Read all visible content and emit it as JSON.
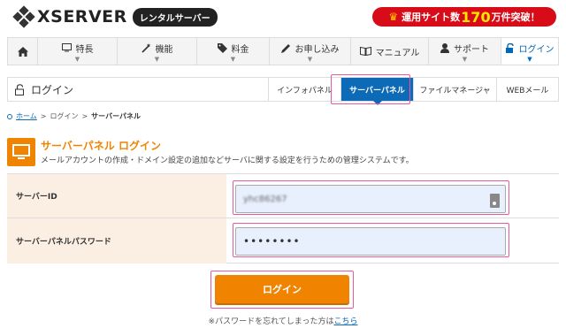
{
  "header": {
    "logo_text": "XSERVER",
    "logo_badge": "レンタルサーバー",
    "campaign_prefix": "運用サイト数",
    "campaign_number": "170",
    "campaign_suffix": "万件突破！"
  },
  "nav": {
    "items": [
      {
        "label": "",
        "icon": "home-icon"
      },
      {
        "label": "特長",
        "icon": "monitor-icon"
      },
      {
        "label": "機能",
        "icon": "magic-wand-icon"
      },
      {
        "label": "料金",
        "icon": "tag-icon"
      },
      {
        "label": "お申し込み",
        "icon": "pencil-icon"
      },
      {
        "label": "マニュアル",
        "icon": "book-icon"
      },
      {
        "label": "サポート",
        "icon": "person-icon"
      },
      {
        "label": "ログイン",
        "icon": "unlock-icon"
      }
    ],
    "active": "ログイン"
  },
  "subbar": {
    "title": "ログイン",
    "tabs": [
      "インフォパネル",
      "サーバーパネル",
      "ファイルマネージャ",
      "WEBメール"
    ],
    "active_tab": "サーバーパネル"
  },
  "breadcrumb": {
    "home": "ホーム",
    "sep1": ">",
    "login": "ログイン",
    "sep2": ">",
    "current": "サーバーパネル"
  },
  "panel": {
    "title": "サーバーパネル ログイン",
    "description": "メールアカウントの作成・ドメイン設定の追加などサーバに関する設定を行うための管理システムです。"
  },
  "form": {
    "server_id_label": "サーバーID",
    "server_id_value": "yhc86267",
    "password_label": "サーバーパネルパスワード",
    "password_value": "••••••••"
  },
  "login_button": "ログイン",
  "forgot": {
    "text": "※パスワードを忘れてしまった方は",
    "link": "こちら"
  },
  "colors": {
    "accent_orange": "#f08300",
    "nav_blue": "#0d6ab7",
    "highlight_pink": "#e85aa0",
    "campaign_red": "#d80c18",
    "label_bg": "#fbeee3"
  }
}
